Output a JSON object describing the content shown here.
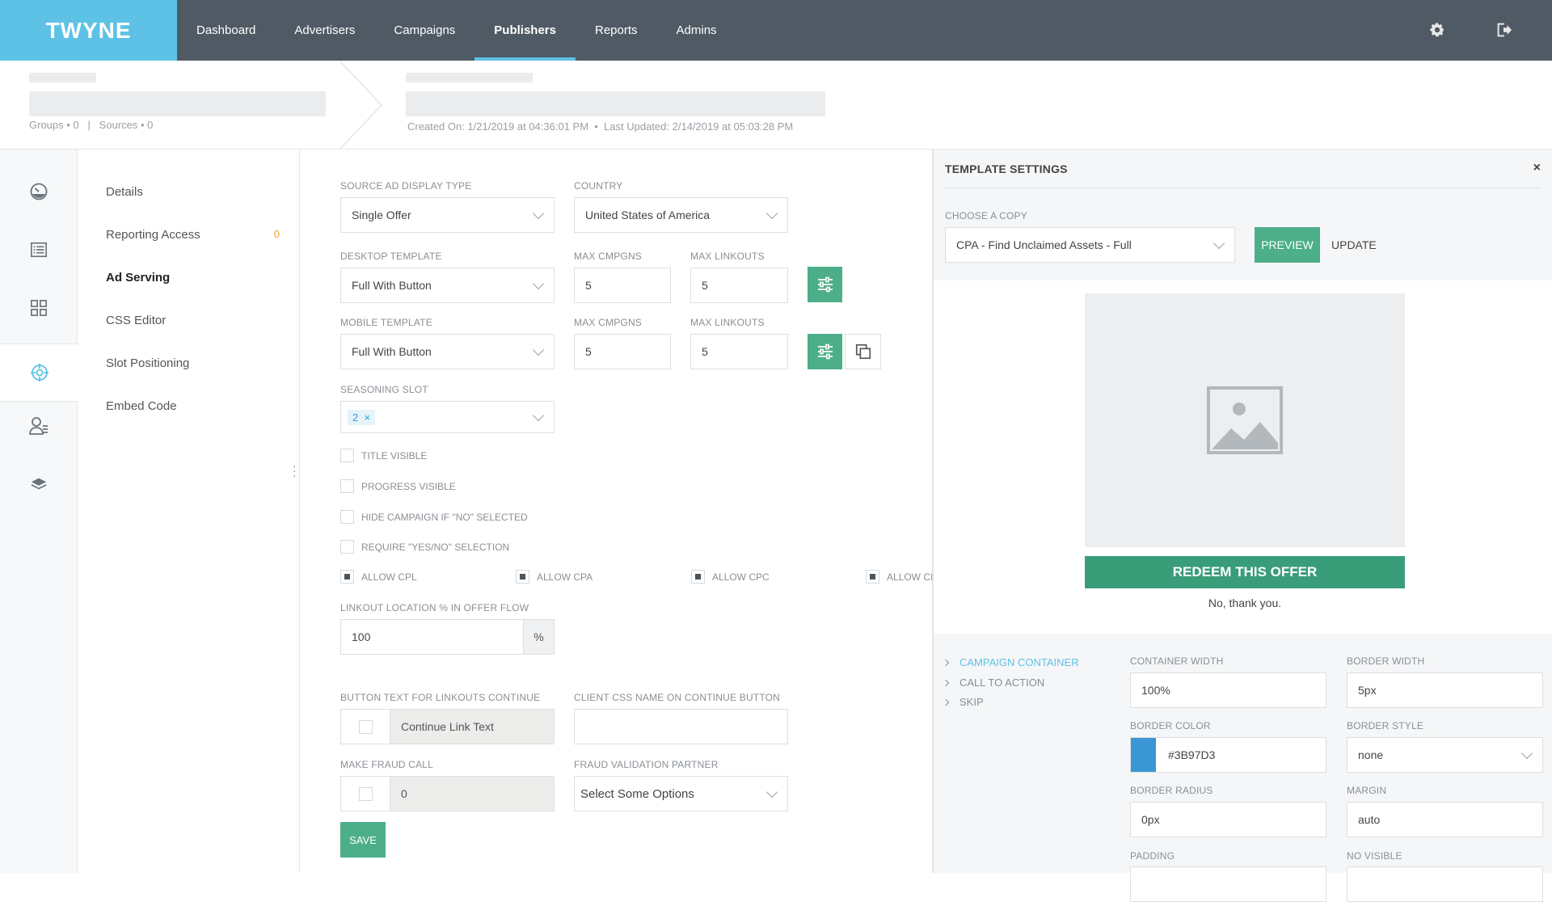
{
  "app": {
    "logo": "TWYNE",
    "nav": [
      "Dashboard",
      "Advertisers",
      "Campaigns",
      "Publishers",
      "Reports",
      "Admins"
    ],
    "active_nav": "Publishers"
  },
  "header": {
    "left_meta": "Groups • 0   |   Sources • 0",
    "right_meta": "Created On: 1/21/2019 at 04:36:01 PM  •  Last Updated: 2/14/2019 at 05:03:28 PM"
  },
  "menu": {
    "items": [
      {
        "label": "Details"
      },
      {
        "label": "Reporting Access",
        "badge": "0"
      },
      {
        "label": "Ad Serving"
      },
      {
        "label": "CSS Editor"
      },
      {
        "label": "Slot Positioning"
      },
      {
        "label": "Embed Code"
      }
    ],
    "active": "Ad Serving"
  },
  "form": {
    "source_ad_display_type": {
      "label": "SOURCE AD DISPLAY TYPE",
      "value": "Single Offer"
    },
    "country": {
      "label": "COUNTRY",
      "value": "United States of America"
    },
    "desktop_template": {
      "label": "DESKTOP TEMPLATE",
      "value": "Full With Button"
    },
    "desktop_max_cmpgns": {
      "label": "MAX CMPGNS",
      "value": "5"
    },
    "desktop_max_linkouts": {
      "label": "MAX LINKOUTS",
      "value": "5"
    },
    "mobile_template": {
      "label": "MOBILE TEMPLATE",
      "value": "Full With Button"
    },
    "mobile_max_cmpgns": {
      "label": "MAX CMPGNS",
      "value": "5"
    },
    "mobile_max_linkouts": {
      "label": "MAX LINKOUTS",
      "value": "5"
    },
    "seasoning_slot": {
      "label": "SEASONING SLOT",
      "tag": "2",
      "tag_remove": "×"
    },
    "checkboxes": [
      {
        "label": "TITLE VISIBLE",
        "checked": false
      },
      {
        "label": "PROGRESS VISIBLE",
        "checked": false
      },
      {
        "label": "HIDE CAMPAIGN IF \"NO\" SELECTED",
        "checked": false
      },
      {
        "label": "REQUIRE \"YES/NO\" SELECTION",
        "checked": false
      }
    ],
    "allow": [
      {
        "label": "ALLOW CPL",
        "checked": true
      },
      {
        "label": "ALLOW CPA",
        "checked": true
      },
      {
        "label": "ALLOW CPC",
        "checked": true
      },
      {
        "label": "ALLOW CI",
        "checked": true
      }
    ],
    "linkout_location": {
      "label": "LINKOUT LOCATION % IN OFFER FLOW",
      "value": "100",
      "suffix": "%"
    },
    "button_text": {
      "label": "BUTTON TEXT FOR LINKOUTS CONTINUE",
      "value": "Continue Link Text"
    },
    "client_css": {
      "label": "CLIENT CSS NAME ON CONTINUE BUTTON",
      "value": ""
    },
    "make_fraud_call": {
      "label": "MAKE FRAUD CALL",
      "value": "0"
    },
    "fraud_partner": {
      "label": "FRAUD VALIDATION PARTNER",
      "placeholder": "Select Some Options"
    },
    "save": "SAVE"
  },
  "panel": {
    "title": "TEMPLATE SETTINGS",
    "close": "×",
    "choose_copy": {
      "label": "CHOOSE A COPY",
      "value": "CPA - Find Unclaimed Assets - Full"
    },
    "preview": "PREVIEW",
    "update": "UPDATE",
    "redeem": "REDEEM THIS OFFER",
    "no_thanks": "No, thank you.",
    "tree": [
      "CAMPAIGN CONTAINER",
      "CALL TO ACTION",
      "SKIP"
    ],
    "tree_active": "CAMPAIGN CONTAINER",
    "container_width": {
      "label": "CONTAINER WIDTH",
      "value": "100%"
    },
    "border_width": {
      "label": "BORDER WIDTH",
      "value": "5px"
    },
    "border_color": {
      "label": "BORDER COLOR",
      "value": "#3B97D3",
      "swatch": "#3b97d3"
    },
    "border_style": {
      "label": "BORDER STYLE",
      "value": "none"
    },
    "border_radius": {
      "label": "BORDER RADIUS",
      "value": "0px"
    },
    "margin": {
      "label": "MARGIN",
      "value": "auto"
    },
    "padding": {
      "label": "PADDING"
    },
    "no_visible": {
      "label": "NO VISIBLE"
    }
  },
  "colors": {
    "brand": "#5ec2e6",
    "nav_bg": "#505a64",
    "accent_green": "#4caf8a",
    "redeem_green": "#3a9d7a",
    "badge_orange": "#f0a030"
  }
}
